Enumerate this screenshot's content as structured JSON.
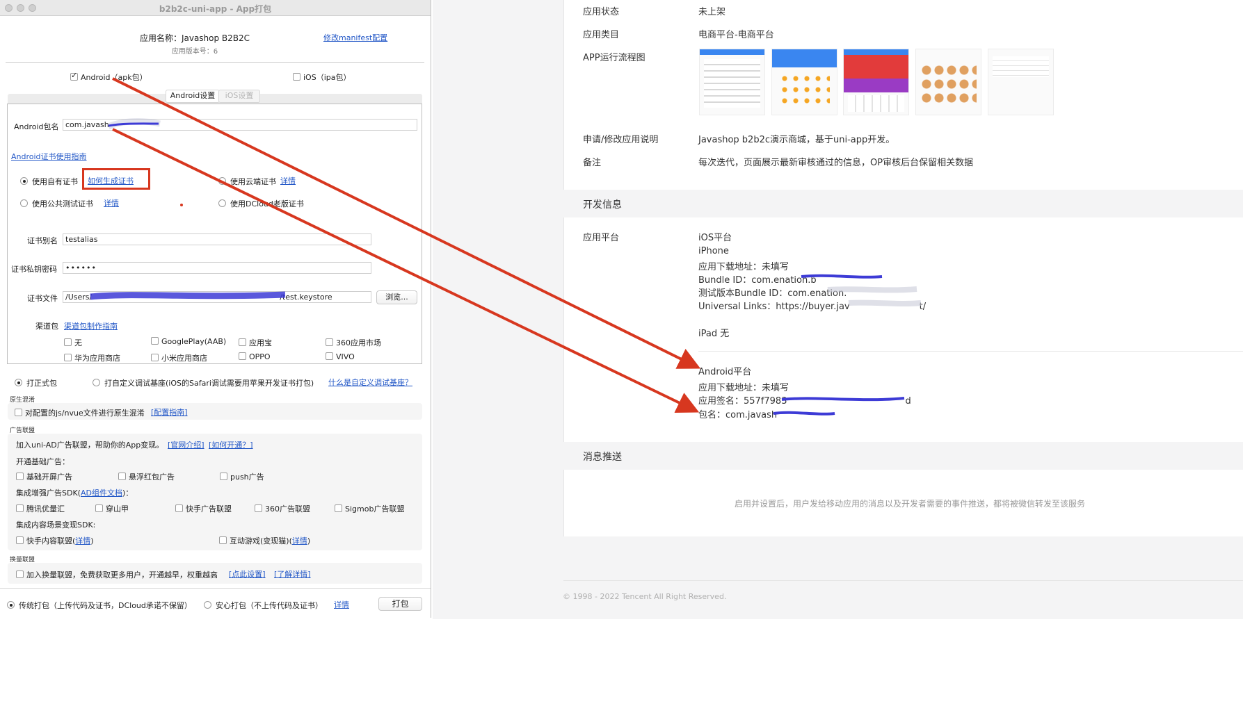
{
  "window": {
    "title": "b2b2c-uni-app - App打包"
  },
  "app": {
    "name_line": "应用名称：Javashop B2B2C",
    "version_line": "应用版本号：6",
    "manifest_link": "修改manifest配置"
  },
  "platforms": {
    "android": "Android（apk包）",
    "ios": "iOS（ipa包）"
  },
  "tabs": {
    "android": "Android设置",
    "ios": "iOS设置"
  },
  "android": {
    "package_label": "Android包名",
    "package_value": "com.javash",
    "cert_guide": "Android证书使用指南",
    "own_cert": "使用自有证书",
    "how_to_gen": "如何生成证书",
    "cloud_cert": "使用云端证书",
    "cloud_detail": "详情",
    "public_cert": "使用公共测试证书",
    "public_detail": "详情",
    "dcloud_cert": "使用DCloud老版证书",
    "alias_label": "证书别名",
    "alias_value": "testalias",
    "pwd_label": "证书私钥密码",
    "pwd_value": "••••••",
    "file_label": "证书文件",
    "file_value": "/Users/",
    "file_value_tail": "/test.keystore",
    "browse": "浏览...",
    "channel_label": "渠道包",
    "channel_guide": "渠道包制作指南",
    "channels": [
      "无",
      "GooglePlay(AAB)",
      "应用宝",
      "360应用市场",
      "华为应用商店",
      "小米应用商店",
      "OPPO",
      "VIVO"
    ]
  },
  "build_mode": {
    "formal": "打正式包",
    "custom": "打自定义调试基座(iOS的Safari调试需要用苹果开发证书打包)",
    "what_is": "什么是自定义调试基座？"
  },
  "obfuscation": {
    "title": "原生混淆",
    "option": "对配置的js/nvue文件进行原生混淆",
    "guide": "[配置指南]"
  },
  "ads": {
    "title": "广告联盟",
    "intro": "加入uni-AD广告联盟，帮助你的App变现。",
    "site": "[官网介绍]",
    "howto": "[如何开通？]",
    "basic_title": "开通基础广告：",
    "basic": [
      "基础开屏广告",
      "悬浮红包广告",
      "push广告"
    ],
    "sdk_title_a": "集成增强广告SDK(",
    "sdk_link": "AD组件文档",
    "sdk_title_b": ")：",
    "sdk": [
      "腾讯优量汇",
      "穿山甲",
      "快手广告联盟",
      "360广告联盟",
      "Sigmob广告联盟"
    ],
    "content_title": "集成内容场景变现SDK:",
    "content_a": "快手内容联盟",
    "content_b": "互动游戏(变现猫)",
    "detail_word": "详情"
  },
  "exchange": {
    "title": "换量联盟",
    "option": "加入换量联盟，免费获取更多用户，开通越早，权重越高",
    "setup": "[点此设置]",
    "learn": "[了解详情]"
  },
  "footer": {
    "traditional": "传统打包（上传代码及证书，DCloud承诺不保留）",
    "safe": "安心打包（不上传代码及证书）",
    "detail": "详情",
    "pack": "打包"
  },
  "page": {
    "rows": {
      "status_label": "应用状态",
      "status_value": "未上架",
      "category_label": "应用类目",
      "category_value": "电商平台-电商平台",
      "flow_label": "APP运行流程图",
      "desc_label": "申请/修改应用说明",
      "desc_value": "Javashop b2b2c演示商城，基于uni-app开发。",
      "note_label": "备注",
      "note_value": "每次迭代，页面展示最新审核通过的信息，OP审核后台保留相关数据"
    },
    "dev_title": "开发信息",
    "platform_label": "应用平台",
    "ios": {
      "title": "iOS平台",
      "device": "iPhone",
      "download": "应用下载地址：未填写",
      "bundle": "Bundle ID：com.enation.b",
      "test_bundle": "测试版本Bundle ID：com.enation.",
      "links": "Universal Links：https://buyer.jav",
      "links_tail": "t/",
      "ipad": "iPad 无"
    },
    "android": {
      "title": "Android平台",
      "download": "应用下载地址：未填写",
      "sign": "应用签名：557f7983",
      "sign_tail": "d",
      "package": "包名：com.javash"
    },
    "push_title": "消息推送",
    "push_desc": "启用并设置后，用户发给移动应用的消息以及开发者需要的事件推送，都将被微信转发至该服务",
    "copyright": "© 1998 - 2022 Tencent All Right Reserved."
  },
  "colors": {
    "link": "#2257c7",
    "arrow": "#d7371f",
    "scribble": "#3d3bd6",
    "highlight_box": "#d7371f"
  }
}
